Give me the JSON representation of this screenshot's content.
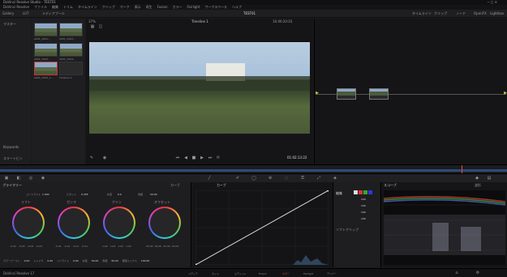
{
  "window": {
    "title": "DaVinci Resolve Studio - TEST01"
  },
  "menu": [
    "DaVinci Resolve",
    "ファイル",
    "編集",
    "トリム",
    "タイムライン",
    "クリップ",
    "マーク",
    "表示",
    "再生",
    "Fusion",
    "カラー",
    "Fairlight",
    "ワークスペース",
    "ヘルプ"
  ],
  "toolbar": {
    "left": [
      "Gallery",
      "LUT",
      "メディアプール"
    ],
    "project": "TEST01",
    "right": [
      "タイムライン",
      "クリップ",
      "ノード",
      "OpenFX",
      "Lightbox"
    ]
  },
  "media_pool": {
    "header": "マスター",
    "clips": [
      {
        "label": "A001_C001...",
        "selected": false
      },
      {
        "label": "A001_C002...",
        "selected": false
      },
      {
        "label": "A001_C003...",
        "selected": false
      },
      {
        "label": "A001_C004...",
        "selected": false
      },
      {
        "label": "A001_C005_1...",
        "selected": true
      },
      {
        "label": "Timeline 1",
        "selected": false
      }
    ],
    "smart_bins": "スマートビン",
    "keywords": "Keywords"
  },
  "viewer": {
    "zoom": "37%",
    "timeline_name": "Timeline 1",
    "timecode_top": "16:06:20:03",
    "timecode": "01:02:13:22"
  },
  "color_panel": {
    "left_title": "プライマリー",
    "mode_label": "カーブ",
    "mode_dropdown": "カーブ",
    "wheel_params": [
      {
        "label": "コントラスト",
        "value": "1.000"
      },
      {
        "label": "ピボット",
        "value": "0.435"
      },
      {
        "label": "彩度",
        "value": "0.0"
      },
      {
        "label": "色相",
        "value": "50.00"
      }
    ],
    "wheels": [
      {
        "name": "リフト",
        "values": [
          "-0.02",
          "-0.03",
          "-0.03",
          "-0.03"
        ]
      },
      {
        "name": "ガンマ",
        "values": [
          "-0.01",
          "-0.01",
          "-0.01",
          "-0.01"
        ]
      },
      {
        "name": "ゲイン",
        "values": [
          "1.02",
          "1.02",
          "1.02",
          "1.02"
        ]
      },
      {
        "name": "オフセット",
        "values": [
          "25.00",
          "25.00",
          "25.00",
          "25.00"
        ]
      }
    ],
    "bottom_params": [
      {
        "label": "カラーブースト",
        "value": "0.00"
      },
      {
        "label": "シャドウ",
        "value": "0.00"
      },
      {
        "label": "ハイライト",
        "value": "0.00"
      },
      {
        "label": "彩度",
        "value": "50.00"
      },
      {
        "label": "色相",
        "value": "50.00"
      },
      {
        "label": "輝度ミックス",
        "value": "100.00"
      }
    ],
    "curve_header": "編集",
    "curve_values": [
      "100",
      "100",
      "100",
      "100"
    ],
    "soft_clip": "ソフトクリップ",
    "scopes_title": "スコープ",
    "scope_type": "波形"
  },
  "pages": [
    {
      "label": "メディア"
    },
    {
      "label": "カット"
    },
    {
      "label": "エディット"
    },
    {
      "label": "Fusion"
    },
    {
      "label": "カラー"
    },
    {
      "label": "Fairlight"
    },
    {
      "label": "デリバー"
    }
  ],
  "footer": {
    "app_label": "DaVinci Resolve 17"
  },
  "colors": {
    "accent": "#c0392b",
    "bg": "#1a1a1c",
    "playhead": "#e74c3c"
  }
}
